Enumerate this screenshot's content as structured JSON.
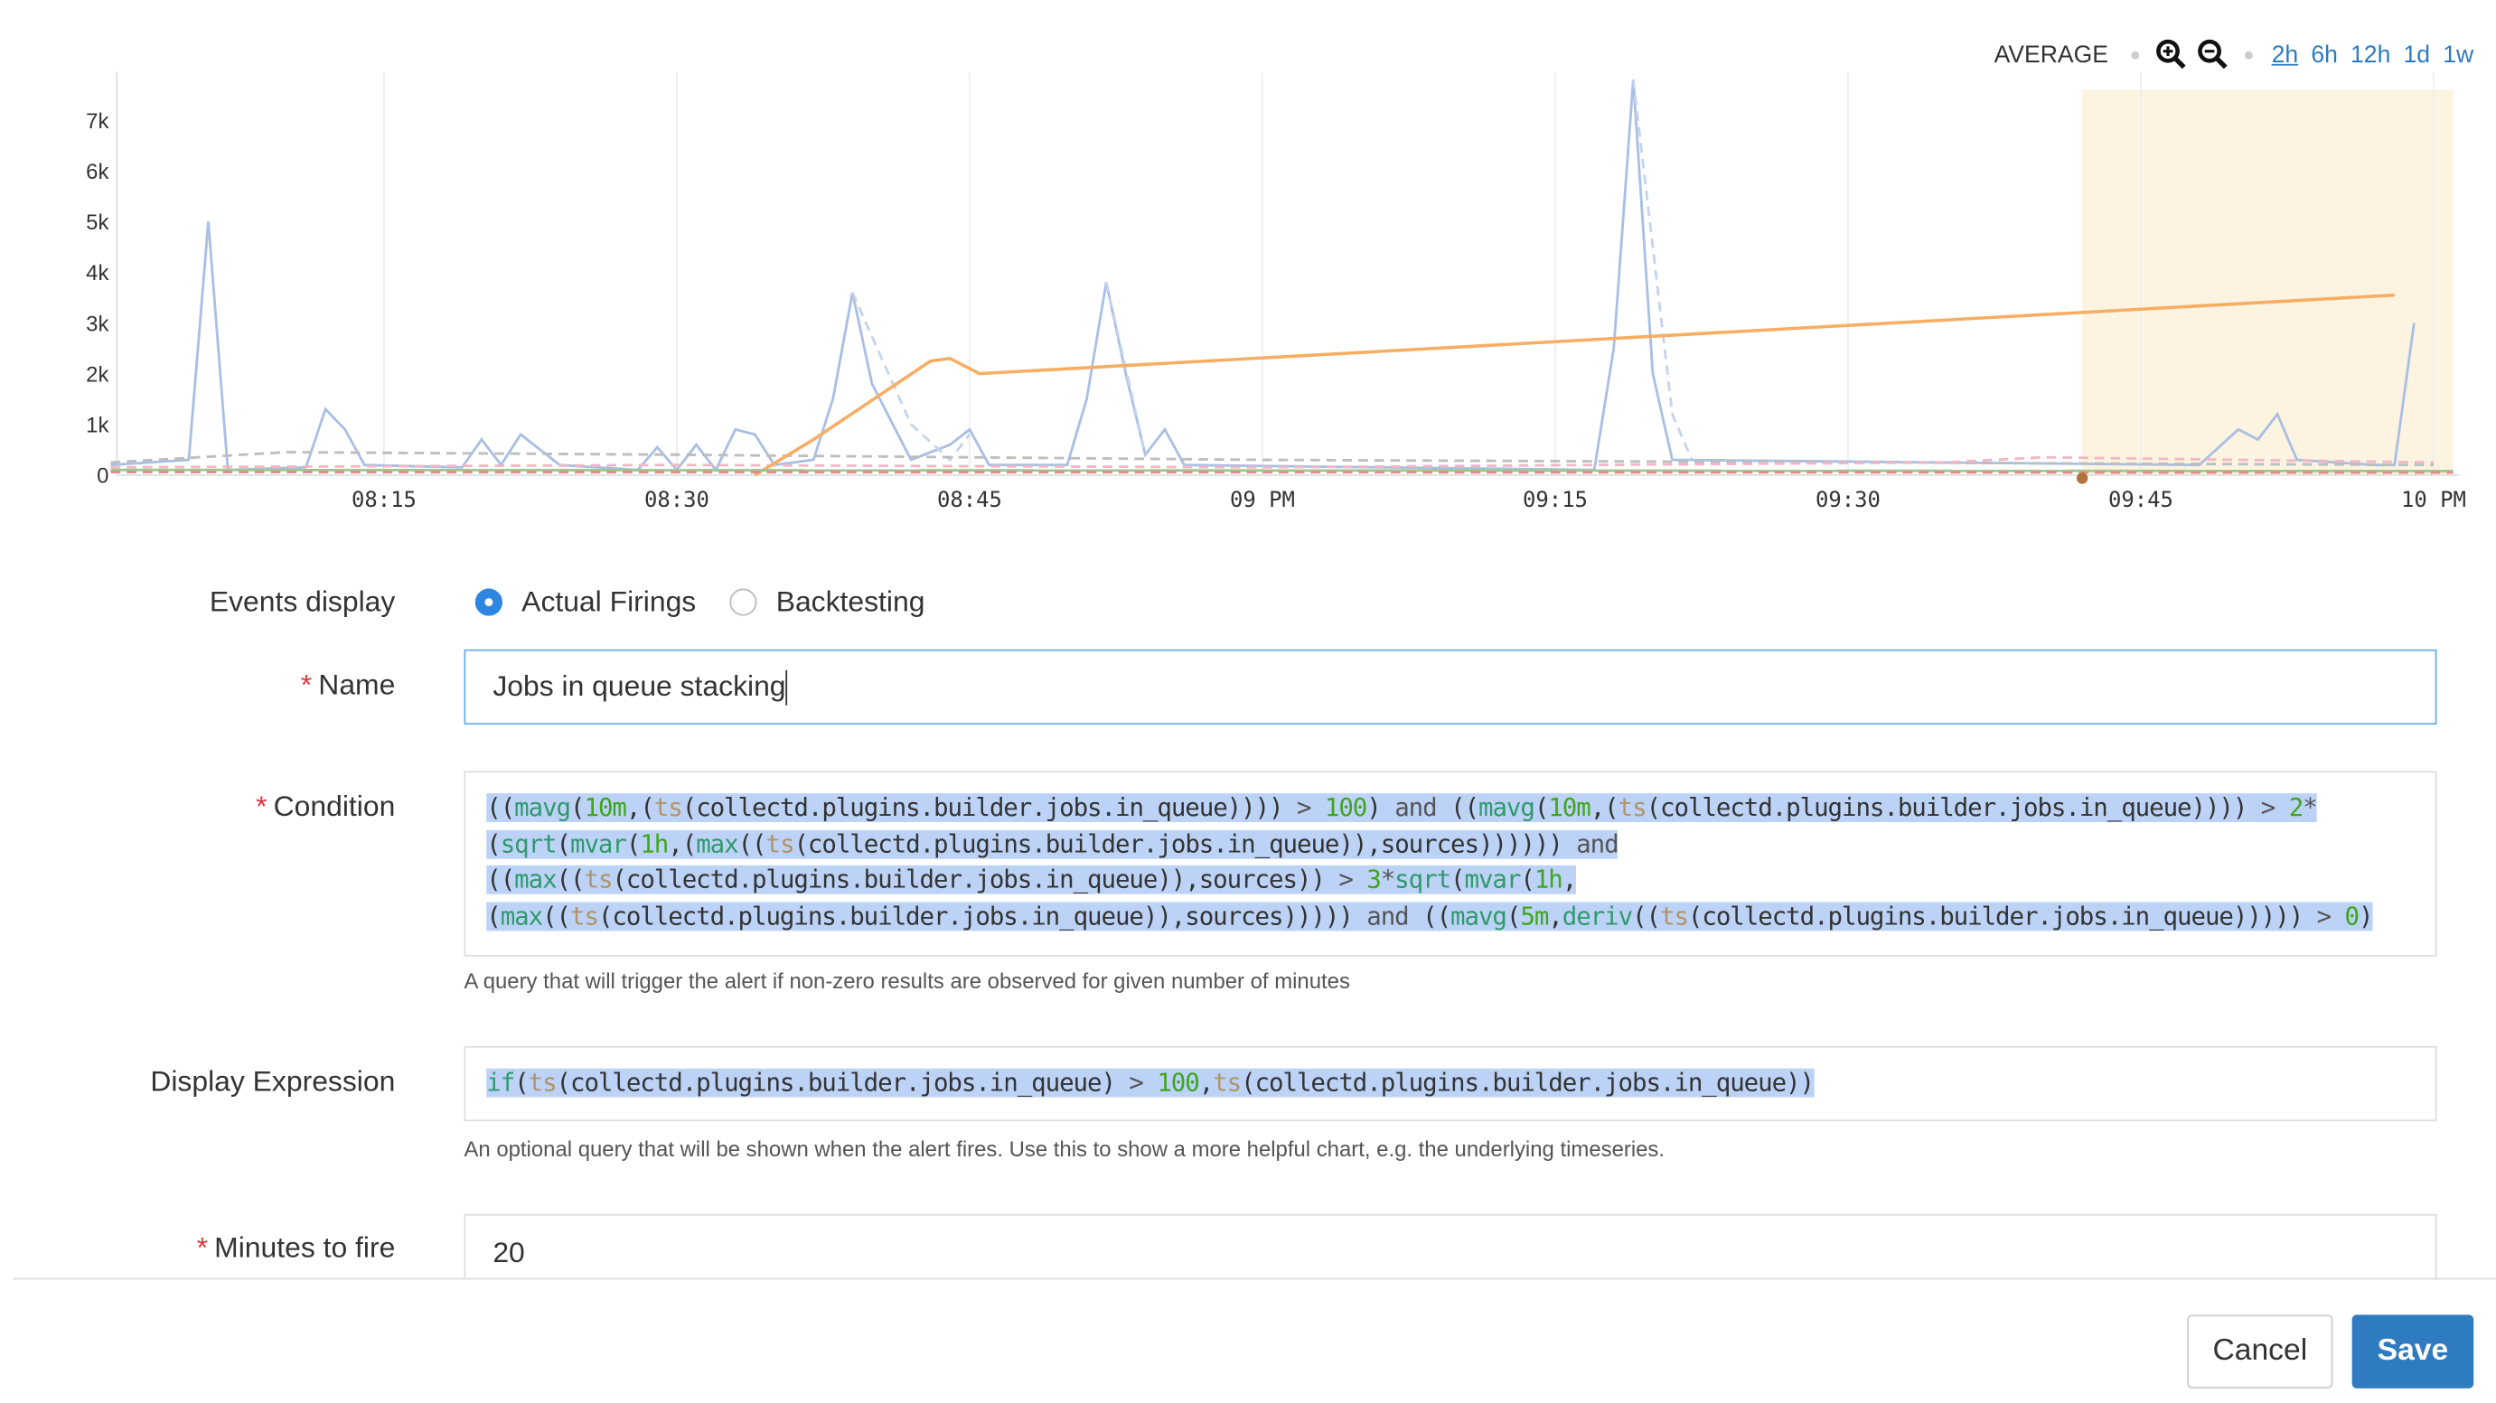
{
  "chart_controls": {
    "aggregation": "AVERAGE",
    "zoom_in_icon": "zoom-in-icon",
    "zoom_out_icon": "zoom-out-icon",
    "ranges": [
      "2h",
      "6h",
      "12h",
      "1d",
      "1w"
    ],
    "selected_range": "2h"
  },
  "chart_data": {
    "type": "line",
    "x_ticks": [
      "08:15",
      "08:30",
      "08:45",
      "09 PM",
      "09:15",
      "09:30",
      "09:45",
      "10 PM"
    ],
    "y_ticks": [
      "0",
      "1k",
      "2k",
      "3k",
      "4k",
      "5k",
      "6k",
      "7k"
    ],
    "ylim": [
      0,
      7800
    ],
    "xlim": [
      "08:01",
      "10:01"
    ],
    "grid": true,
    "highlight_region": [
      "09:42",
      "10:01"
    ],
    "highlight_color": "#fdf3e1",
    "event_marker": "09:42",
    "series": [
      {
        "style": "solid",
        "color": "#a9bfe3",
        "points": [
          [
            "08:01",
            200
          ],
          [
            "08:05",
            300
          ],
          [
            "08:06",
            5000
          ],
          [
            "08:07",
            100
          ],
          [
            "08:11",
            150
          ],
          [
            "08:12",
            1300
          ],
          [
            "08:13",
            900
          ],
          [
            "08:14",
            200
          ],
          [
            "08:19",
            150
          ],
          [
            "08:20",
            700
          ],
          [
            "08:21",
            200
          ],
          [
            "08:22",
            800
          ],
          [
            "08:24",
            200
          ],
          [
            "08:28",
            100
          ],
          [
            "08:29",
            550
          ],
          [
            "08:30",
            100
          ],
          [
            "08:31",
            600
          ],
          [
            "08:32",
            100
          ],
          [
            "08:33",
            900
          ],
          [
            "08:34",
            800
          ],
          [
            "08:35",
            200
          ],
          [
            "08:37",
            300
          ],
          [
            "08:38",
            1500
          ],
          [
            "08:39",
            3600
          ],
          [
            "08:40",
            1800
          ],
          [
            "08:42",
            300
          ],
          [
            "08:44",
            600
          ],
          [
            "08:45",
            900
          ],
          [
            "08:46",
            200
          ],
          [
            "08:50",
            200
          ],
          [
            "08:51",
            1500
          ],
          [
            "08:52",
            3800
          ],
          [
            "08:53",
            2000
          ],
          [
            "08:54",
            400
          ],
          [
            "08:55",
            900
          ],
          [
            "08:56",
            200
          ],
          [
            "09:17",
            100
          ],
          [
            "09:18",
            2500
          ],
          [
            "09:19",
            7800
          ],
          [
            "09:20",
            2000
          ],
          [
            "09:21",
            300
          ],
          [
            "09:48",
            200
          ],
          [
            "09:50",
            900
          ],
          [
            "09:51",
            700
          ],
          [
            "09:52",
            1200
          ],
          [
            "09:53",
            300
          ],
          [
            "09:57",
            200
          ],
          [
            "09:58",
            200
          ],
          [
            "09:59",
            3000
          ]
        ]
      },
      {
        "style": "dashed",
        "color": "#c4d3ee",
        "points": [
          [
            "08:39",
            3600
          ],
          [
            "08:42",
            1000
          ],
          [
            "08:44",
            300
          ],
          [
            "08:45",
            800
          ]
        ]
      },
      {
        "style": "dashed",
        "color": "#c4d3ee",
        "points": [
          [
            "08:52",
            3800
          ],
          [
            "08:54",
            400
          ]
        ]
      },
      {
        "style": "dashed",
        "color": "#c4d3ee",
        "points": [
          [
            "09:19",
            7800
          ],
          [
            "09:21",
            1200
          ],
          [
            "09:22",
            300
          ]
        ]
      },
      {
        "style": "dashed",
        "color": "#bdbdbd",
        "points": [
          [
            "08:01",
            250
          ],
          [
            "08:10",
            450
          ],
          [
            "08:30",
            400
          ],
          [
            "09:00",
            300
          ],
          [
            "09:30",
            250
          ],
          [
            "10:00",
            200
          ]
        ]
      },
      {
        "style": "dashed",
        "color": "#f2b6c6",
        "points": [
          [
            "08:01",
            150
          ],
          [
            "08:30",
            200
          ],
          [
            "09:00",
            150
          ],
          [
            "09:35",
            250
          ],
          [
            "09:40",
            350
          ],
          [
            "09:50",
            300
          ],
          [
            "10:00",
            250
          ]
        ]
      },
      {
        "style": "solid",
        "color": "#f7ad62",
        "points": [
          [
            "08:34",
            0
          ],
          [
            "08:37",
            700
          ],
          [
            "08:43",
            2250
          ],
          [
            "08:44",
            2300
          ],
          [
            "08:45.5",
            2000
          ],
          [
            "09:58",
            3550
          ]
        ]
      },
      {
        "style": "solid",
        "color": "#9bc98a",
        "points": [
          [
            "08:01",
            100
          ],
          [
            "10:01",
            80
          ]
        ]
      },
      {
        "style": "dashed",
        "color": "#e38a8a",
        "points": [
          [
            "08:01",
            60
          ],
          [
            "10:01",
            50
          ]
        ]
      }
    ]
  },
  "form": {
    "events_display": {
      "label": "Events display",
      "options": [
        "Actual Firings",
        "Backtesting"
      ],
      "selected": "Actual Firings"
    },
    "name": {
      "label": "Name",
      "value": "Jobs in queue stacking"
    },
    "condition": {
      "label": "Condition",
      "value": "((mavg(10m,(ts(collectd.plugins.builder.jobs.in_queue)))) > 100) and ((mavg(10m,(ts(collectd.plugins.builder.jobs.in_queue)))) > 2*(sqrt(mvar(1h,(max((ts(collectd.plugins.builder.jobs.in_queue)),sources)))))) and ((max((ts(collectd.plugins.builder.jobs.in_queue)),sources)) > 3*sqrt(mvar(1h,(max((ts(collectd.plugins.builder.jobs.in_queue)),sources))))) and ((mavg(5m,deriv((ts(collectd.plugins.builder.jobs.in_queue))))) > 0)",
      "help": "A query that will trigger the alert if non-zero results are observed for given number of minutes"
    },
    "display_expression": {
      "label": "Display Expression",
      "value": "if(ts(collectd.plugins.builder.jobs.in_queue) > 100,ts(collectd.plugins.builder.jobs.in_queue))",
      "help": "An optional query that will be shown when the alert fires. Use this to show a more helpful chart, e.g. the underlying timeseries."
    },
    "minutes_to_fire": {
      "label": "Minutes to fire",
      "value": "20"
    },
    "required_mark": "*"
  },
  "footer": {
    "cancel_label": "Cancel",
    "save_label": "Save"
  },
  "colors": {
    "accent": "#2f7bbf",
    "link": "#2a7bc4",
    "required": "#d9363e",
    "selection": "#bcd3f7"
  }
}
